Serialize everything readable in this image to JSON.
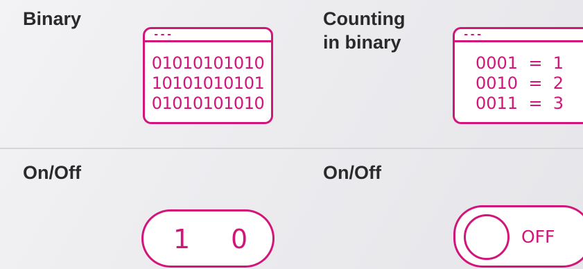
{
  "colors": {
    "accent": "#d1157a",
    "text": "#2a2a2a"
  },
  "binary": {
    "label": "Binary",
    "window": {
      "titlebar_dashes": "---",
      "lines": [
        "01010101010",
        "10101010101",
        "01010101010"
      ]
    }
  },
  "counting": {
    "label": "Counting\nin binary",
    "window": {
      "titlebar_dashes": "---",
      "lines": [
        "0001  =  1",
        "0010  =  2",
        "0011  =  3"
      ]
    }
  },
  "onoff_left": {
    "label": "On/Off",
    "toggle": {
      "on_digit": "1",
      "off_digit": "0"
    }
  },
  "onoff_right": {
    "label": "On/Off",
    "switch": {
      "state_label": "OFF"
    }
  }
}
